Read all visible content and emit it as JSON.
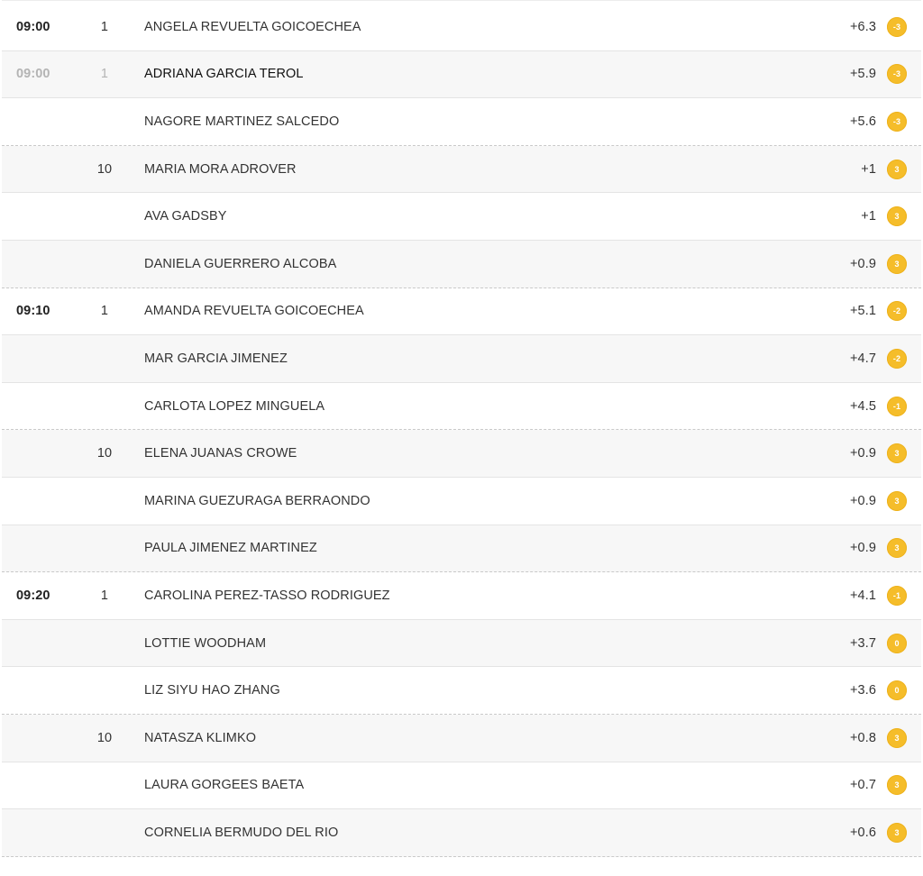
{
  "accent_color": "#f5bd2a",
  "rows": [
    {
      "time": "09:00",
      "tee": "1",
      "name": "ANGELA REVUELTA GOICOECHEA",
      "score": "+6.3",
      "badge": "-3"
    },
    {
      "time": "09:00",
      "tee": "1",
      "name": "ADRIANA GARCIA TEROL",
      "score": "+5.9",
      "badge": "-3"
    },
    {
      "time": "",
      "tee": "",
      "name": "NAGORE MARTINEZ SALCEDO",
      "score": "+5.6",
      "badge": "-3"
    },
    {
      "time": "",
      "tee": "10",
      "name": "MARIA MORA ADROVER",
      "score": "+1",
      "badge": "3"
    },
    {
      "time": "",
      "tee": "",
      "name": "AVA GADSBY",
      "score": "+1",
      "badge": "3"
    },
    {
      "time": "",
      "tee": "",
      "name": "DANIELA GUERRERO ALCOBA",
      "score": "+0.9",
      "badge": "3"
    },
    {
      "time": "09:10",
      "tee": "1",
      "name": "AMANDA REVUELTA GOICOECHEA",
      "score": "+5.1",
      "badge": "-2"
    },
    {
      "time": "",
      "tee": "",
      "name": "MAR GARCIA JIMENEZ",
      "score": "+4.7",
      "badge": "-2"
    },
    {
      "time": "",
      "tee": "",
      "name": "CARLOTA LOPEZ MINGUELA",
      "score": "+4.5",
      "badge": "-1"
    },
    {
      "time": "",
      "tee": "10",
      "name": "ELENA JUANAS CROWE",
      "score": "+0.9",
      "badge": "3"
    },
    {
      "time": "",
      "tee": "",
      "name": "MARINA GUEZURAGA BERRAONDO",
      "score": "+0.9",
      "badge": "3"
    },
    {
      "time": "",
      "tee": "",
      "name": "PAULA JIMENEZ MARTINEZ",
      "score": "+0.9",
      "badge": "3"
    },
    {
      "time": "09:20",
      "tee": "1",
      "name": "CAROLINA PEREZ-TASSO RODRIGUEZ",
      "score": "+4.1",
      "badge": "-1"
    },
    {
      "time": "",
      "tee": "",
      "name": "LOTTIE WOODHAM",
      "score": "+3.7",
      "badge": "0"
    },
    {
      "time": "",
      "tee": "",
      "name": "LIZ SIYU HAO ZHANG",
      "score": "+3.6",
      "badge": "0"
    },
    {
      "time": "",
      "tee": "10",
      "name": "NATASZA KLIMKO",
      "score": "+0.8",
      "badge": "3"
    },
    {
      "time": "",
      "tee": "",
      "name": "LAURA GORGEES BAETA",
      "score": "+0.7",
      "badge": "3"
    },
    {
      "time": "",
      "tee": "",
      "name": "CORNELIA BERMUDO DEL RIO",
      "score": "+0.6",
      "badge": "3"
    }
  ]
}
